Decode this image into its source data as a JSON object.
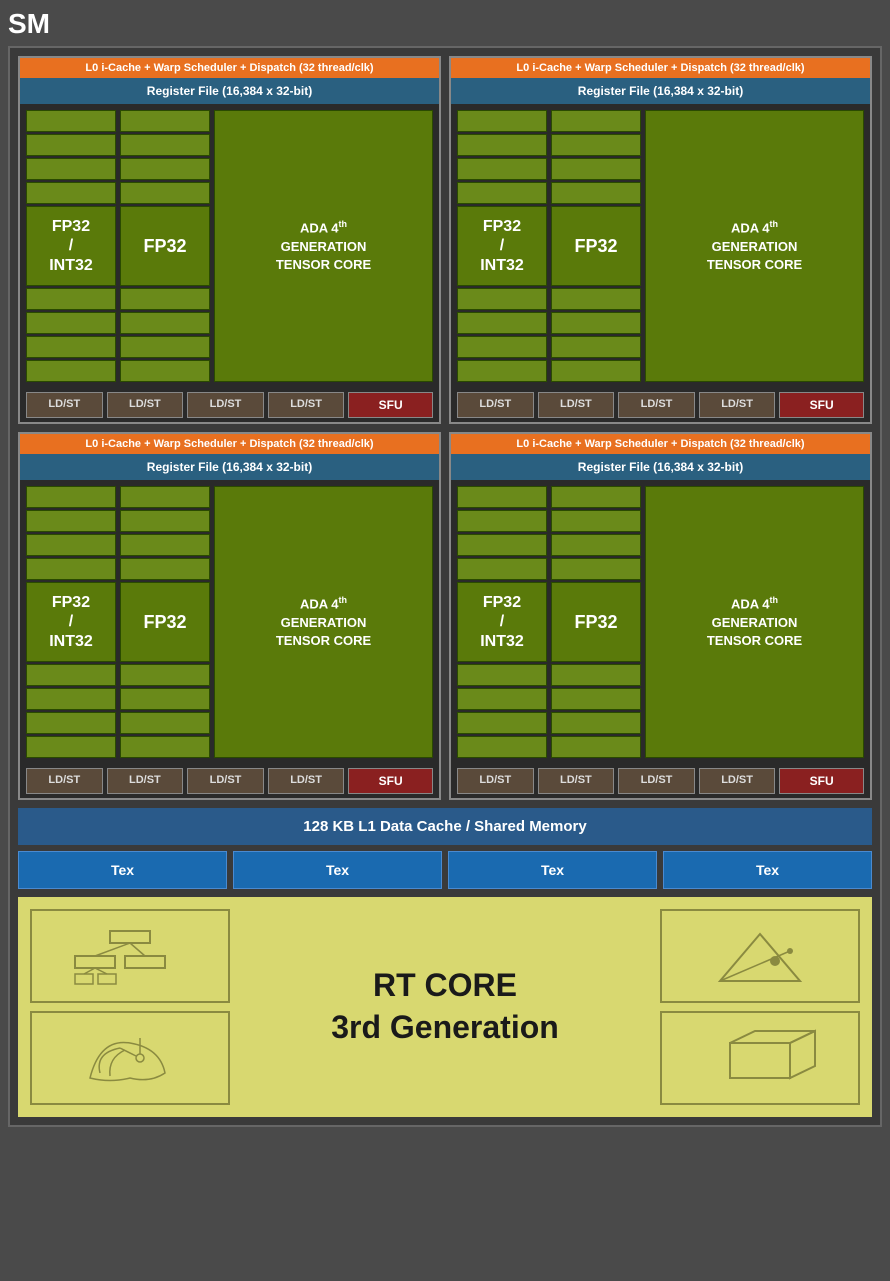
{
  "title": "SM",
  "blocks": [
    {
      "l0_label": "L0 i-Cache + Warp Scheduler + Dispatch (32 thread/clk)",
      "register_label": "Register File (16,384 x 32-bit)",
      "fp32_int32_label": "FP32\n/\nINT32",
      "fp32_label": "FP32",
      "tensor_label": "ADA 4th GENERATION TENSOR CORE",
      "ld_st_labels": [
        "LD/ST",
        "LD/ST",
        "LD/ST",
        "LD/ST"
      ],
      "sfu_label": "SFU"
    },
    {
      "l0_label": "L0 i-Cache + Warp Scheduler + Dispatch (32 thread/clk)",
      "register_label": "Register File (16,384 x 32-bit)",
      "fp32_int32_label": "FP32\n/\nINT32",
      "fp32_label": "FP32",
      "tensor_label": "ADA 4th GENERATION TENSOR CORE",
      "ld_st_labels": [
        "LD/ST",
        "LD/ST",
        "LD/ST",
        "LD/ST"
      ],
      "sfu_label": "SFU"
    },
    {
      "l0_label": "L0 i-Cache + Warp Scheduler + Dispatch (32 thread/clk)",
      "register_label": "Register File (16,384 x 32-bit)",
      "fp32_int32_label": "FP32\n/\nINT32",
      "fp32_label": "FP32",
      "tensor_label": "ADA 4th GENERATION TENSOR CORE",
      "ld_st_labels": [
        "LD/ST",
        "LD/ST",
        "LD/ST",
        "LD/ST"
      ],
      "sfu_label": "SFU"
    },
    {
      "l0_label": "L0 i-Cache + Warp Scheduler + Dispatch (32 thread/clk)",
      "register_label": "Register File (16,384 x 32-bit)",
      "fp32_int32_label": "FP32\n/\nINT32",
      "fp32_label": "FP32",
      "tensor_label": "ADA 4th GENERATION TENSOR CORE",
      "ld_st_labels": [
        "LD/ST",
        "LD/ST",
        "LD/ST",
        "LD/ST"
      ],
      "sfu_label": "SFU"
    }
  ],
  "l1_cache_label": "128 KB L1 Data Cache / Shared Memory",
  "tex_labels": [
    "Tex",
    "Tex",
    "Tex",
    "Tex"
  ],
  "rt_core_label": "RT CORE\n3rd Generation"
}
